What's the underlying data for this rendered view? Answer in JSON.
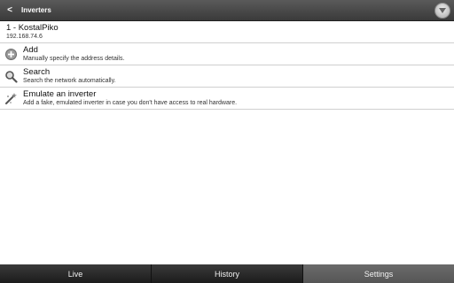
{
  "header": {
    "back_icon": "chevron-left",
    "title": "Inverters",
    "menu_icon": "circle-chevron-down"
  },
  "inverter": {
    "name": "1 - KostalPiko",
    "address": "192.168.74.6"
  },
  "actions": [
    {
      "icon": "plus-circle-icon",
      "title": "Add",
      "description": "Manually specify the address details."
    },
    {
      "icon": "magnifier-icon",
      "title": "Search",
      "description": "Search the network automatically."
    },
    {
      "icon": "wand-icon",
      "title": "Emulate an inverter",
      "description": "Add a fake, emulated inverter in case you don't have access to real hardware."
    }
  ],
  "tabs": [
    {
      "label": "Live",
      "active": false
    },
    {
      "label": "History",
      "active": false
    },
    {
      "label": "Settings",
      "active": true
    }
  ]
}
